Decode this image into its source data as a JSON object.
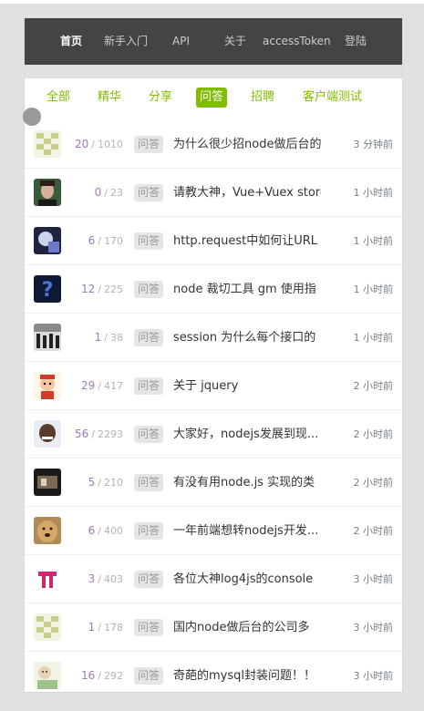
{
  "colors": {
    "nav_bg": "#444444",
    "accent": "#80bd01",
    "reply_count": "#9e78c0",
    "visit_count": "#b4b4b4",
    "badge_bg": "#e5e5e5"
  },
  "nav": {
    "items": [
      {
        "label": "首页",
        "active": true
      },
      {
        "label": "新手入门"
      },
      {
        "label": "API"
      },
      {
        "label": "关于"
      },
      {
        "label": "accessToken"
      },
      {
        "label": "登陆"
      }
    ]
  },
  "tabs": [
    {
      "label": "全部"
    },
    {
      "label": "精华"
    },
    {
      "label": "分享"
    },
    {
      "label": "问答",
      "active": true
    },
    {
      "label": "招聘"
    },
    {
      "label": "客户端测试"
    }
  ],
  "topics": [
    {
      "reply": "20",
      "visit": "1010",
      "tag": "问答",
      "title": "为什么很少招node做后台的",
      "time": "3 分钟前",
      "avatar": "pixel-avatar"
    },
    {
      "reply": "0",
      "visit": "23",
      "tag": "问答",
      "title": "请教大神，Vue+Vuex store",
      "time": "1 小时前",
      "avatar": "portrait-avatar"
    },
    {
      "reply": "6",
      "visit": "170",
      "tag": "问答",
      "title": "http.request中如何让URL",
      "time": "1 小时前",
      "avatar": "blue-avatar"
    },
    {
      "reply": "12",
      "visit": "225",
      "tag": "问答",
      "title": "node 裁切工具 gm 使用指",
      "time": "1 小时前",
      "avatar": "question-avatar"
    },
    {
      "reply": "1",
      "visit": "38",
      "tag": "问答",
      "title": "session 为什么每个接口的",
      "time": "1 小时前",
      "avatar": "bw-avatar"
    },
    {
      "reply": "29",
      "visit": "417",
      "tag": "问答",
      "title": "关于 jquery",
      "time": "2 小时前",
      "avatar": "cartoon-avatar"
    },
    {
      "reply": "56",
      "visit": "2293",
      "tag": "问答",
      "title": "大家好，nodejs发展到现...",
      "time": "2 小时前",
      "avatar": "face-avatar"
    },
    {
      "reply": "5",
      "visit": "210",
      "tag": "问答",
      "title": "有没有用node.js 实现的类",
      "time": "2 小时前",
      "avatar": "dark-avatar"
    },
    {
      "reply": "6",
      "visit": "400",
      "tag": "问答",
      "title": "一年前端想转nodejs开发...",
      "time": "2 小时前",
      "avatar": "dog-avatar"
    },
    {
      "reply": "3",
      "visit": "403",
      "tag": "问答",
      "title": "各位大神log4js的console",
      "time": "3 小时前",
      "avatar": "pink-avatar"
    },
    {
      "reply": "1",
      "visit": "178",
      "tag": "问答",
      "title": "国内node做后台的公司多",
      "time": "3 小时前",
      "avatar": "pixel-avatar"
    },
    {
      "reply": "16",
      "visit": "292",
      "tag": "问答",
      "title": "奇葩的mysql封装问题！！",
      "time": "3 小时前",
      "avatar": "drawing-avatar"
    }
  ]
}
